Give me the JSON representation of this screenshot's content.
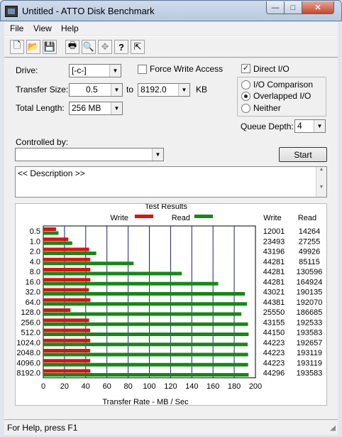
{
  "window": {
    "title": "Untitled - ATTO Disk Benchmark",
    "min": "—",
    "max": "□",
    "close": "✕"
  },
  "menu": {
    "file": "File",
    "view": "View",
    "help": "Help"
  },
  "toolbar": {
    "buttons": [
      "new-icon",
      "open-icon",
      "save-icon",
      "print-icon",
      "print-preview-icon",
      "move-icon",
      "help-icon",
      "context-help-icon"
    ],
    "glyphs": {
      "new": "🗋",
      "open": "📂",
      "save": "💾",
      "print": "🖶",
      "preview": "🔍",
      "move": "✥",
      "help": "?",
      "context_help": "⇱"
    }
  },
  "form": {
    "drive_label": "Drive:",
    "drive_value": "[-c-]",
    "force_write_label": "Force Write Access",
    "direct_io_label": "Direct I/O",
    "direct_io_checked": true,
    "transfer_size_label": "Transfer Size:",
    "transfer_from": "0.5",
    "to_label": "to",
    "transfer_to": "8192.0",
    "kb_label": "KB",
    "total_length_label": "Total Length:",
    "total_length_value": "256 MB",
    "io_comparison_label": "I/O Comparison",
    "overlapped_io_label": "Overlapped I/O",
    "neither_label": "Neither",
    "queue_depth_label": "Queue Depth:",
    "queue_depth_value": "4",
    "controlled_by_label": "Controlled by:",
    "controlled_by_value": "",
    "start_button": "Start",
    "description": "<< Description >>"
  },
  "results": {
    "group_title": "Test Results",
    "write_legend": "Write",
    "read_legend": "Read",
    "write_col": "Write",
    "read_col": "Read",
    "xlabel": "Transfer Rate - MB / Sec",
    "write_color": "#e01010",
    "read_color": "#138a13",
    "grid_color": "#1a1aa8"
  },
  "chart_data": {
    "type": "bar",
    "orientation": "horizontal",
    "categories": [
      "0.5",
      "1.0",
      "2.0",
      "4.0",
      "8.0",
      "16.0",
      "32.0",
      "64.0",
      "128.0",
      "256.0",
      "512.0",
      "1024.0",
      "2048.0",
      "4096.0",
      "8192.0"
    ],
    "series": [
      {
        "name": "Write",
        "values": [
          12.0,
          23.5,
          43.2,
          44.3,
          44.3,
          44.3,
          43.0,
          44.4,
          25.6,
          43.2,
          44.2,
          44.2,
          44.2,
          44.2,
          44.3
        ],
        "labels": [
          "12001",
          "23493",
          "43196",
          "44281",
          "44281",
          "44281",
          "43021",
          "44381",
          "25550",
          "43155",
          "44150",
          "44223",
          "44223",
          "44223",
          "44296"
        ]
      },
      {
        "name": "Read",
        "values": [
          14.3,
          27.3,
          49.9,
          85.1,
          130.6,
          164.9,
          190.1,
          192.1,
          186.7,
          193.0,
          193.6,
          192.7,
          193.1,
          193.1,
          193.6
        ],
        "labels": [
          "14264",
          "27255",
          "49926",
          "85115",
          "130596",
          "164924",
          "190135",
          "192070",
          "186685",
          "192533",
          "193583",
          "192657",
          "193119",
          "193119",
          "193583"
        ]
      }
    ],
    "xlim": [
      0,
      200
    ],
    "xticks": [
      0,
      20,
      40,
      60,
      80,
      100,
      120,
      140,
      160,
      180,
      200
    ],
    "xlabel": "Transfer Rate - MB / Sec"
  },
  "status": {
    "text": "For Help, press F1"
  }
}
